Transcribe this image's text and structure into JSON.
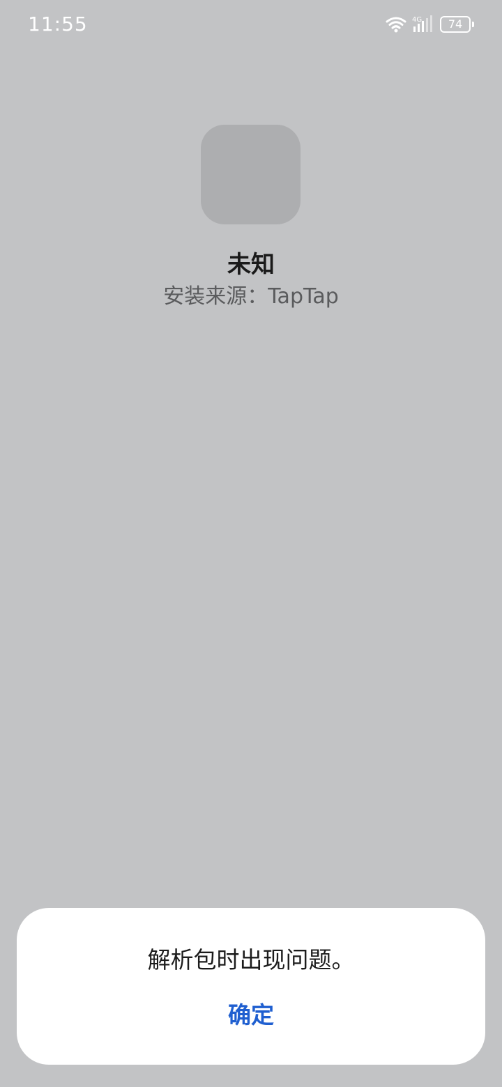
{
  "status_bar": {
    "time": "11:55",
    "network_label": "4G",
    "battery_level": "74",
    "icons": [
      "wifi-icon",
      "cellular-signal-icon",
      "battery-icon"
    ]
  },
  "app": {
    "icon": "app-placeholder-icon",
    "name": "未知",
    "source": "安装来源：TapTap"
  },
  "dialog": {
    "message": "解析包时出现问题。",
    "confirm_label": "确定"
  },
  "colors": {
    "background": "#c2c3c5",
    "accent": "#1f5fd0",
    "dialog_background": "#ffffff"
  }
}
